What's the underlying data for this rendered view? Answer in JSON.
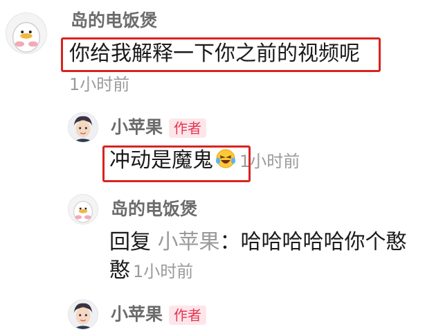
{
  "comments": [
    {
      "username": "岛的电饭煲",
      "text": "你给我解释一下你之前的视频呢",
      "time": "1小时前"
    }
  ],
  "replies": [
    {
      "username": "小苹果",
      "badge": "作者",
      "text": "冲动是魔鬼",
      "emoji": "laughing-crying-emoji",
      "time": "1小时前"
    },
    {
      "username": "岛的电饭煲",
      "reply_prefix": "回复",
      "reply_target": "小苹果",
      "reply_colon": "：",
      "text_line1": "哈哈哈哈哈你个憨",
      "text_line2": "憨",
      "time": "1小时前"
    },
    {
      "username": "小苹果",
      "badge": "作者"
    }
  ],
  "colors": {
    "highlight": "#d9231f",
    "badge_text": "#e53552",
    "badge_bg": "#fde6ea",
    "username": "#6b6b6b",
    "timestamp": "#9a9a9a"
  }
}
